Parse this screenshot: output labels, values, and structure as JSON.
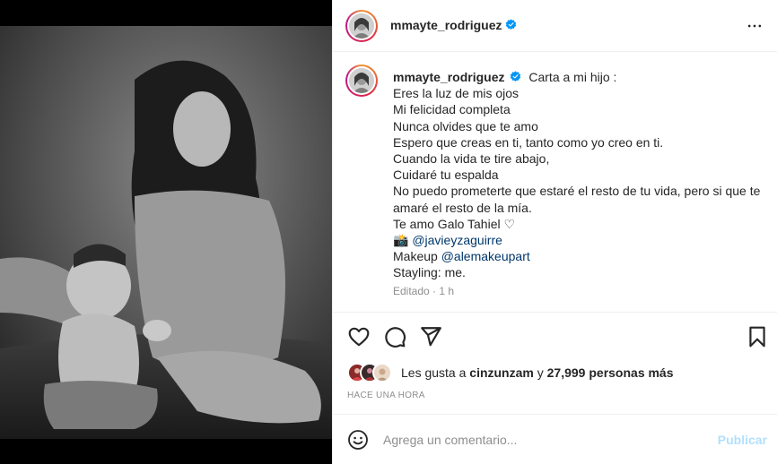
{
  "post": {
    "author": "mmayte_rodriguez",
    "caption": {
      "first_line": "Carta a mi hijo :",
      "lines": [
        "Eres la luz de mis ojos",
        "Mi felicidad completa",
        "Nunca olvides que te amo",
        "Espero que creas en ti, tanto como yo creo en ti.",
        "Cuando la vida te tire abajo,",
        "Cuidaré tu espalda",
        "No puedo prometerte que estaré el resto de tu vida, pero si que te amaré el resto de la mía.",
        "Te amo Galo Tahiel ♡"
      ],
      "photo_credit_icon": "📸",
      "photo_credit_mention": "@javieyzaguirre",
      "makeup_label": "Makeup",
      "makeup_mention": "@alemakeupart",
      "styling": "Stayling: me."
    },
    "edited_meta": "Editado · 1 h",
    "likes": {
      "prefix": "Les gusta a",
      "first_user": "cinzunzam",
      "connector": "y",
      "others": "27,999 personas más"
    },
    "timestamp": "HACE UNA HORA"
  },
  "comment": {
    "placeholder": "Agrega un comentario...",
    "publish_label": "Publicar"
  },
  "icons": {
    "more": "more-options-icon",
    "like": "heart-icon",
    "comment": "comment-icon",
    "share": "send-icon",
    "save": "bookmark-icon",
    "emoji": "emoji-icon",
    "verified": "verified-badge-icon"
  },
  "colors": {
    "verified": "#0095f6",
    "mention": "#00376b",
    "publish_disabled": "#b2dffc",
    "muted": "#8e8e8e"
  }
}
